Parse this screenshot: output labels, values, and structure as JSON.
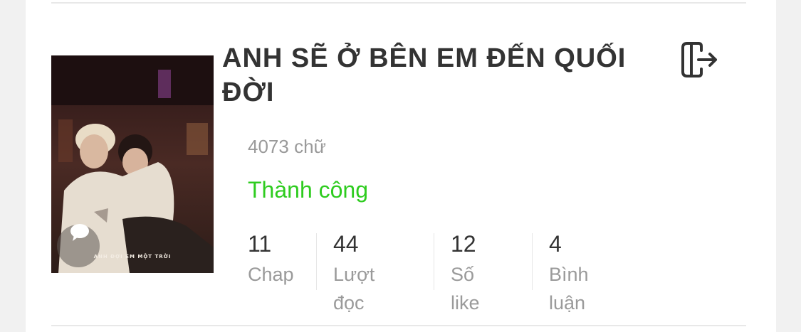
{
  "story": {
    "title": "ANH SẼ Ở BÊN EM ĐẾN QUỐI ĐỜI",
    "word_count": "4073 chữ",
    "status": "Thành công",
    "status_color": "#2ecc1f",
    "cover_caption": "ANH ĐỢI EM MỘT TRỜI",
    "stats": [
      {
        "value": "11",
        "label": "Chap"
      },
      {
        "value": "44",
        "label": "Lượt đọc"
      },
      {
        "value": "12",
        "label": "Số like"
      },
      {
        "value": "4",
        "label": "Bình luận"
      }
    ],
    "action_icon": "exit-icon"
  }
}
